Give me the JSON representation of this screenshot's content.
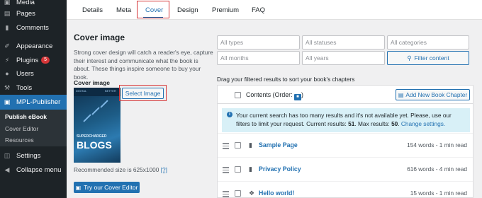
{
  "sidebar": {
    "items": [
      {
        "label": "Media",
        "icon": "media-icon"
      },
      {
        "label": "Pages",
        "icon": "pages-icon"
      },
      {
        "label": "Comments",
        "icon": "comments-icon"
      },
      {
        "label": "Appearance",
        "icon": "appearance-icon"
      },
      {
        "label": "Plugins",
        "icon": "plugins-icon",
        "badge": "5"
      },
      {
        "label": "Users",
        "icon": "users-icon"
      },
      {
        "label": "Tools",
        "icon": "tools-icon"
      },
      {
        "label": "MPL-Publisher",
        "icon": "book-icon"
      },
      {
        "label": "Settings",
        "icon": "settings-icon"
      },
      {
        "label": "Collapse menu",
        "icon": "collapse-icon"
      }
    ],
    "submenu": [
      "Publish eBook",
      "Cover Editor",
      "Resources"
    ],
    "active_color": "#2271b1",
    "badge_color": "#d63638"
  },
  "tabs": [
    "Details",
    "Meta",
    "Cover",
    "Design",
    "Premium",
    "FAQ"
  ],
  "cover_section": {
    "title": "Cover image",
    "description": "Strong cover design will catch a reader's eye, capture their interest and communicate what the book is about. These things inspire someone to buy your book.",
    "label": "Cover image",
    "select_button": "Select Image",
    "recommended": "Recommended size is 625x1000",
    "help_link": "[?]",
    "try_button": "Try our Cover Editor",
    "cover_text_top": "SUPERCHARGED",
    "cover_text_main": "BLOGS",
    "cover_corner_left": "DIGITAL",
    "cover_corner_right": "BETTER"
  },
  "filters": {
    "types": "All types",
    "statuses": "All statuses",
    "categories": "All categories",
    "months": "All months",
    "years": "All years",
    "button": "Filter content"
  },
  "chapters": {
    "hint": "Drag your filtered results to sort your book's chapters",
    "header_label": "Contents (Order:",
    "header_close": ")",
    "add_button": "Add New Book Chapter",
    "notice_pre": "Your current search has too many results and it's not available yet. Please, use our filters to limit your request. Current results:",
    "notice_current": "51",
    "notice_mid": ". Max results:",
    "notice_max": "50",
    "notice_post": ".",
    "notice_link": "Change settings.",
    "rows": [
      {
        "title": "Sample Page",
        "meta": "154 words - 1 min read",
        "type": "page"
      },
      {
        "title": "Privacy Policy",
        "meta": "616 words - 4 min read",
        "type": "page"
      },
      {
        "title": "Hello world!",
        "meta": "15 words - 1 min read",
        "type": "post"
      }
    ]
  }
}
